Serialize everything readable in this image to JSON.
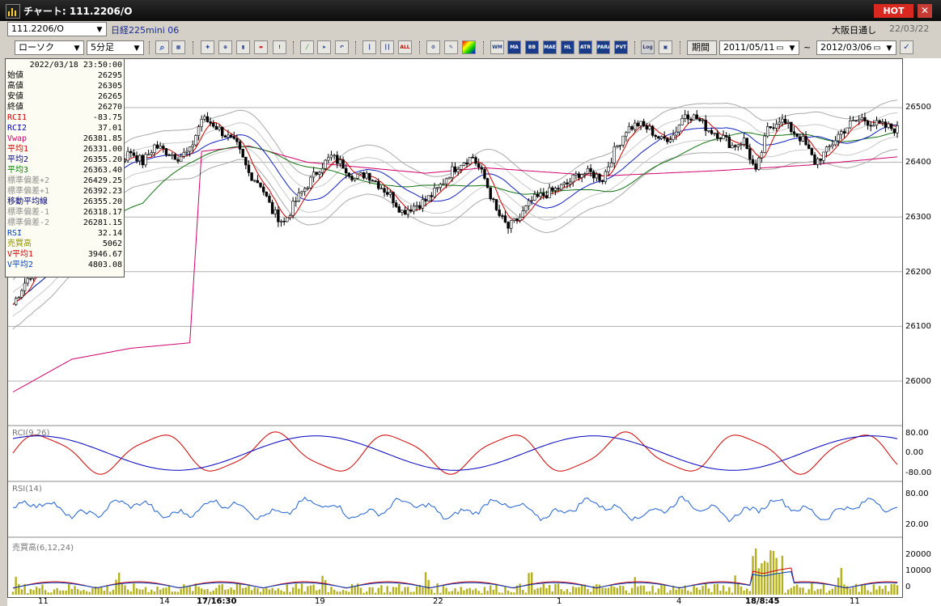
{
  "window": {
    "title": "チャート: 111.2206/O",
    "hot_label": "HOT",
    "close_glyph": "✕"
  },
  "header": {
    "symbol": "111.2206/O",
    "name": "日経225mini 06",
    "session": "大阪日通し",
    "date": "22/03/22",
    "chart_type": "ローソク",
    "interval": "5分足",
    "period_label": "期間",
    "from_date": "2011/05/11",
    "to_date": "2012/03/06",
    "tilde": "~"
  },
  "toolbar": {
    "icons": [
      "search-icon",
      "table-icon",
      "crosshair-icon",
      "zoom-icon",
      "bar-icon",
      "split-icon",
      "warning-icon",
      "draw-icon",
      "cursor-icon",
      "undo-icon",
      "candle-icon",
      "candle-split-icon",
      "all-icon",
      "gear-icon",
      "pen-icon",
      "color-icon"
    ],
    "tags": [
      "MA",
      "BB",
      "MAE",
      "HL",
      "ATR",
      "PARA",
      "PVT",
      "Log"
    ]
  },
  "info_panel": {
    "datetime": "2022/03/18  23:50:00",
    "rows": [
      {
        "label": "始値",
        "value": "26295",
        "color": "#000000"
      },
      {
        "label": "高値",
        "value": "26305",
        "color": "#000000"
      },
      {
        "label": "安値",
        "value": "26265",
        "color": "#000000"
      },
      {
        "label": "終値",
        "value": "26270",
        "color": "#000000"
      },
      {
        "label": "RCI1",
        "value": "-83.75",
        "color": "#d00000"
      },
      {
        "label": "RCI2",
        "value": "37.01",
        "color": "#0000c0"
      },
      {
        "label": "Vwap",
        "value": "26381.85",
        "color": "#d0006a"
      },
      {
        "label": "平均1",
        "value": "26331.00",
        "color": "#d00000"
      },
      {
        "label": "平均2",
        "value": "26355.20",
        "color": "#000080"
      },
      {
        "label": "平均3",
        "value": "26363.40",
        "color": "#008000"
      },
      {
        "label": "標準偏差+2",
        "value": "26429.25",
        "color": "#909090"
      },
      {
        "label": "標準偏差+1",
        "value": "26392.23",
        "color": "#909090"
      },
      {
        "label": "移動平均線",
        "value": "26355.20",
        "color": "#000080"
      },
      {
        "label": "標準偏差-1",
        "value": "26318.17",
        "color": "#909090"
      },
      {
        "label": "標準偏差-2",
        "value": "26281.15",
        "color": "#909090"
      },
      {
        "label": "RSI",
        "value": "32.14",
        "color": "#0040c0"
      },
      {
        "label": "売買高",
        "value": "5062",
        "color": "#909000"
      },
      {
        "label": "V平均1",
        "value": "3946.67",
        "color": "#d00000"
      },
      {
        "label": "V平均2",
        "value": "4803.08",
        "color": "#0040c0"
      }
    ]
  },
  "panes": {
    "rci_label": "RCI(9,26)",
    "rsi_label": "RSI(14)",
    "vol_label": "売買高(6,12,24)"
  },
  "price_axis": [
    "26500",
    "26400",
    "26300",
    "26200",
    "26100",
    "26000"
  ],
  "rci_axis": [
    "80.00",
    "0.00",
    "-80.00"
  ],
  "rsi_axis": [
    "80.00",
    "20.00"
  ],
  "vol_axis": [
    "20000",
    "10000",
    "0"
  ],
  "x_labels": [
    "11",
    "14",
    "17/16:30",
    "19",
    "22",
    "1",
    "4",
    "18/8:45",
    "11"
  ],
  "chart_data": {
    "type": "line",
    "series_kind": "candlestick",
    "ylim": [
      25930,
      26560
    ],
    "price_ticks": [
      26500,
      26400,
      26300,
      26200,
      26100,
      26000
    ],
    "close_path": [
      [
        0,
        26140
      ],
      [
        4,
        26180
      ],
      [
        8,
        26210
      ],
      [
        12,
        26250
      ],
      [
        16,
        26320
      ],
      [
        20,
        26360
      ],
      [
        24,
        26380
      ],
      [
        28,
        26400
      ],
      [
        32,
        26410
      ],
      [
        36,
        26400
      ],
      [
        40,
        26420
      ],
      [
        44,
        26400
      ],
      [
        48,
        26430
      ],
      [
        52,
        26420
      ],
      [
        56,
        26410
      ],
      [
        60,
        26420
      ],
      [
        64,
        26480
      ],
      [
        68,
        26470
      ],
      [
        72,
        26450
      ],
      [
        76,
        26430
      ],
      [
        80,
        26380
      ],
      [
        84,
        26360
      ],
      [
        88,
        26310
      ],
      [
        92,
        26290
      ],
      [
        96,
        26330
      ],
      [
        100,
        26360
      ],
      [
        104,
        26390
      ],
      [
        108,
        26410
      ],
      [
        112,
        26395
      ],
      [
        116,
        26370
      ],
      [
        120,
        26380
      ],
      [
        124,
        26360
      ],
      [
        128,
        26340
      ],
      [
        132,
        26310
      ],
      [
        136,
        26320
      ],
      [
        140,
        26330
      ],
      [
        144,
        26350
      ],
      [
        148,
        26380
      ],
      [
        152,
        26400
      ],
      [
        156,
        26410
      ],
      [
        160,
        26370
      ],
      [
        164,
        26310
      ],
      [
        168,
        26280
      ],
      [
        172,
        26300
      ],
      [
        176,
        26330
      ],
      [
        180,
        26340
      ],
      [
        184,
        26350
      ],
      [
        188,
        26360
      ],
      [
        192,
        26380
      ],
      [
        196,
        26380
      ],
      [
        200,
        26370
      ],
      [
        204,
        26420
      ],
      [
        208,
        26460
      ],
      [
        212,
        26470
      ],
      [
        216,
        26460
      ],
      [
        220,
        26440
      ],
      [
        224,
        26450
      ],
      [
        228,
        26490
      ],
      [
        232,
        26480
      ],
      [
        236,
        26460
      ],
      [
        240,
        26450
      ],
      [
        244,
        26430
      ],
      [
        248,
        26440
      ],
      [
        252,
        26380
      ],
      [
        256,
        26460
      ],
      [
        260,
        26480
      ],
      [
        264,
        26460
      ],
      [
        268,
        26440
      ],
      [
        272,
        26400
      ],
      [
        276,
        26420
      ],
      [
        280,
        26450
      ],
      [
        284,
        26470
      ],
      [
        288,
        26480
      ],
      [
        292,
        26470
      ],
      [
        296,
        26465
      ],
      [
        300,
        26460
      ]
    ],
    "vwap_path": [
      [
        0,
        25980
      ],
      [
        20,
        26040
      ],
      [
        40,
        26060
      ],
      [
        60,
        26070
      ],
      [
        64,
        26420
      ],
      [
        80,
        26430
      ],
      [
        100,
        26400
      ],
      [
        140,
        26380
      ],
      [
        160,
        26390
      ],
      [
        200,
        26375
      ],
      [
        240,
        26385
      ],
      [
        270,
        26395
      ],
      [
        300,
        26410
      ]
    ]
  }
}
